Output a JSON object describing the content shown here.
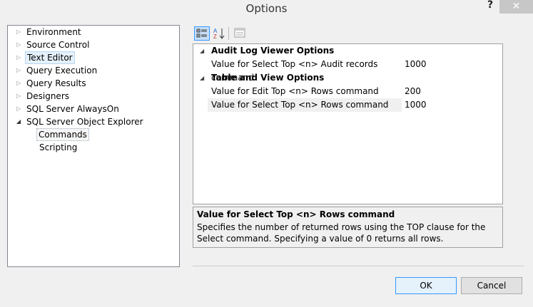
{
  "window": {
    "title": "Options",
    "help_glyph": "?",
    "close_glyph": "✕"
  },
  "tree": {
    "items": [
      {
        "label": "Environment",
        "expander": "▷"
      },
      {
        "label": "Source Control",
        "expander": "▷"
      },
      {
        "label": "Text Editor",
        "expander": "▷"
      },
      {
        "label": "Query Execution",
        "expander": "▷"
      },
      {
        "label": "Query Results",
        "expander": "▷"
      },
      {
        "label": "Designers",
        "expander": "▷"
      },
      {
        "label": "SQL Server AlwaysOn",
        "expander": "▷"
      },
      {
        "label": "SQL Server Object Explorer",
        "expander": "◢"
      },
      {
        "label": "Commands"
      },
      {
        "label": "Scripting"
      }
    ]
  },
  "toolbar": {
    "categorized_icon": "categorized-icon",
    "alphabetical_icon": "sort-az-icon",
    "property_pages_icon": "property-pages-icon",
    "az_glyph": "A↓Z"
  },
  "grid": {
    "categories": [
      {
        "label": "Audit Log Viewer Options",
        "arrow": "◢",
        "properties": [
          {
            "name": "Value for Select Top <n> Audit records command",
            "value": "1000"
          }
        ]
      },
      {
        "label": "Table and View Options",
        "arrow": "◢",
        "properties": [
          {
            "name": "Value for Edit Top <n> Rows command",
            "value": "200"
          },
          {
            "name": "Value for Select Top <n> Rows command",
            "value": "1000"
          }
        ]
      }
    ]
  },
  "description": {
    "title": "Value for Select Top <n> Rows command",
    "text": "Specifies the number of returned rows using the TOP clause for the Select command. Specifying a value of 0 returns all rows."
  },
  "buttons": {
    "ok": "OK",
    "cancel": "Cancel"
  }
}
